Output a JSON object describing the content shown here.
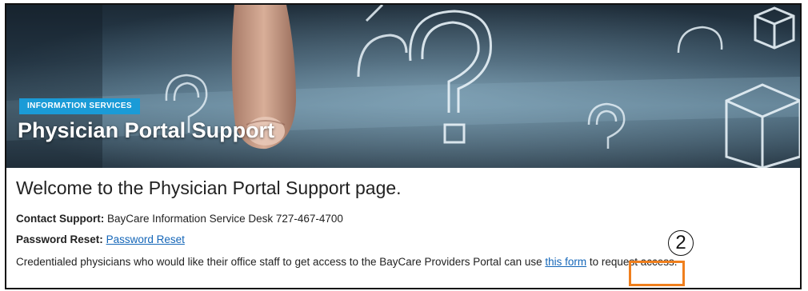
{
  "hero": {
    "tag": "INFORMATION SERVICES",
    "title": "Physician Portal Support"
  },
  "main": {
    "heading": "Welcome to the Physician Portal Support page.",
    "contact": {
      "label": "Contact Support:",
      "value": "BayCare Information Service Desk 727-467-4700"
    },
    "password": {
      "label": "Password Reset:",
      "link": "Password Reset"
    },
    "access": {
      "before": "Credentialed physicians who would like their office staff to get access to the BayCare Providers Portal can use",
      "link": "this form",
      "after": "to request access."
    }
  },
  "annotation": {
    "number": "2",
    "highlight_color": "#f07f1d"
  },
  "colors": {
    "tag_bg": "#1a9bd7",
    "link": "#1466b8"
  }
}
